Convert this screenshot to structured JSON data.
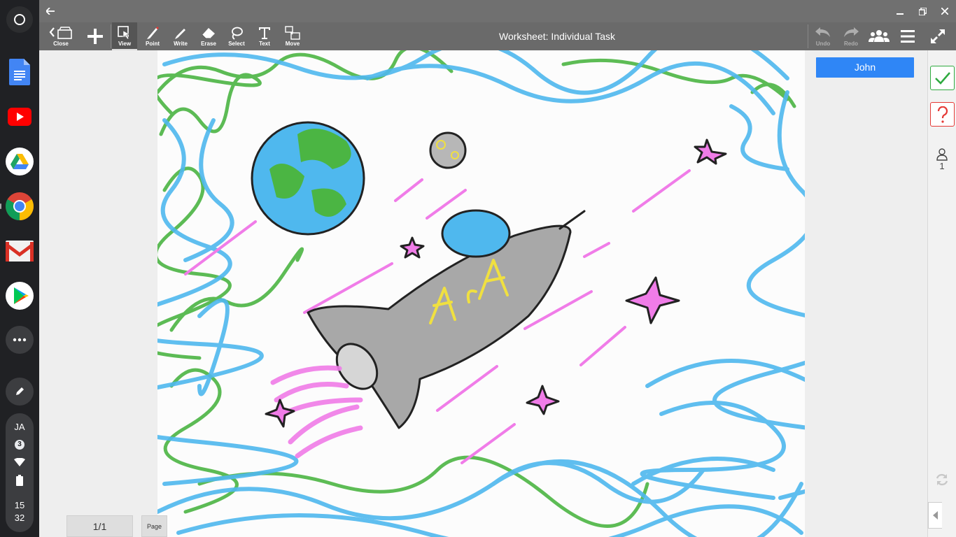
{
  "shelf": {
    "launcher_icon": "launcher-circle-icon",
    "apps": [
      {
        "name": "Google Docs",
        "icon": "docs-icon",
        "color": "#4285f4"
      },
      {
        "name": "YouTube",
        "icon": "youtube-icon",
        "color": "#ff0000"
      },
      {
        "name": "Google Drive",
        "icon": "drive-icon",
        "color": "#1fa463"
      },
      {
        "name": "Chrome",
        "icon": "chrome-icon",
        "color": "#4285f4"
      },
      {
        "name": "Gmail",
        "icon": "gmail-icon",
        "color": "#d93025"
      },
      {
        "name": "Play Store",
        "icon": "play-store-icon",
        "color": "#00c853"
      }
    ],
    "status": {
      "initials": "JA",
      "notifications": "3",
      "clock_hours": "15",
      "clock_minutes": "32"
    }
  },
  "toolbar": {
    "close_label": "Close",
    "tools": [
      {
        "label": "View",
        "icon": "view-cursor-icon",
        "active": true
      },
      {
        "label": "Point",
        "icon": "pointer-pen-icon"
      },
      {
        "label": "Write",
        "icon": "pen-icon"
      },
      {
        "label": "Erase",
        "icon": "eraser-icon"
      },
      {
        "label": "Select",
        "icon": "lasso-icon"
      },
      {
        "label": "Text",
        "icon": "text-icon"
      },
      {
        "label": "Move",
        "icon": "move-icon"
      }
    ],
    "title": "Worksheet: Individual Task",
    "undo_label": "Undo",
    "redo_label": "Redo"
  },
  "workspace": {
    "page_indicator": "1/1",
    "page_tab_label": "Page",
    "student_name": "John"
  },
  "right_panel": {
    "user_count": "1"
  },
  "colors": {
    "toolbar_bg": "#6a6a6a",
    "titlebar_bg": "#707070",
    "accent_blue": "#2f86f6",
    "check_green": "#2eaa3f",
    "help_red": "#e53935",
    "drawing_blue": "#4fb8ee",
    "drawing_green": "#4bb543",
    "drawing_pink": "#f07ce8",
    "drawing_yellow": "#f0e040"
  }
}
